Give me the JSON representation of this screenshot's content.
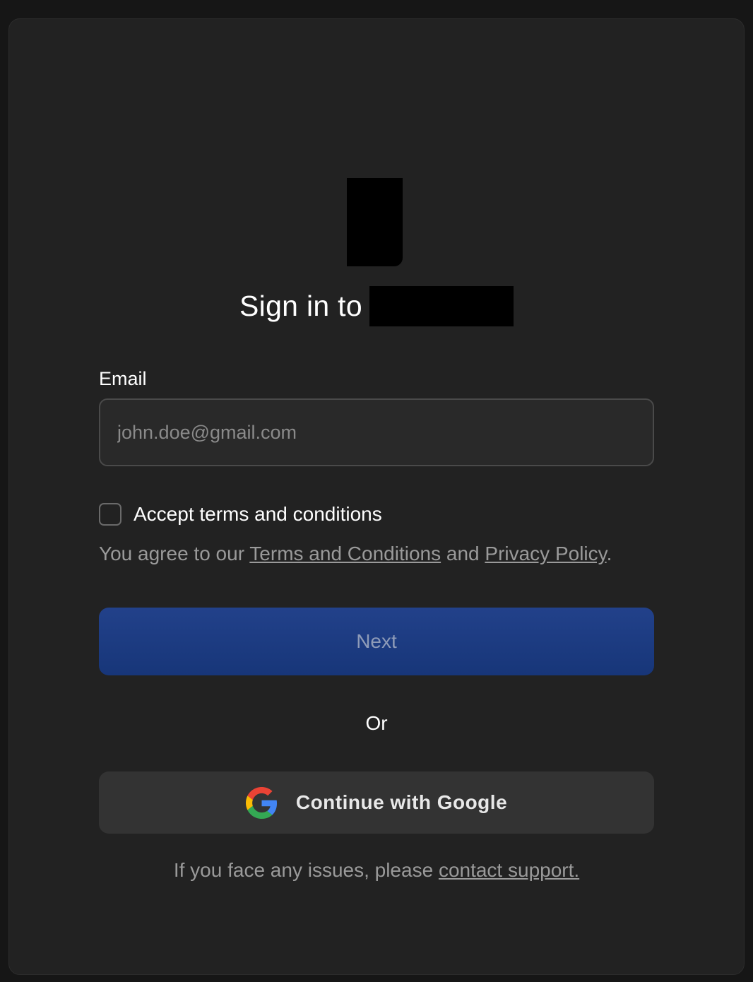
{
  "header": {
    "title": "Sign in to"
  },
  "form": {
    "email_label": "Email",
    "email_placeholder": "john.doe@gmail.com",
    "email_value": "",
    "checkbox_checked": false,
    "checkbox_label": "Accept terms and conditions",
    "agree_prefix": "You agree to our ",
    "terms_link": "Terms and Conditions",
    "agree_and": " and ",
    "privacy_link": "Privacy Policy",
    "agree_suffix": ".",
    "next_label": "Next",
    "or_label": "Or",
    "google_label": "Continue with Google",
    "google_icon": "google-g-icon"
  },
  "footer": {
    "support_prefix": "If you face any issues, please ",
    "support_link": "contact support."
  },
  "colors": {
    "background": "#161616",
    "card": "#222222",
    "primary_button": "#1d3b82",
    "secondary_button": "#333333"
  }
}
